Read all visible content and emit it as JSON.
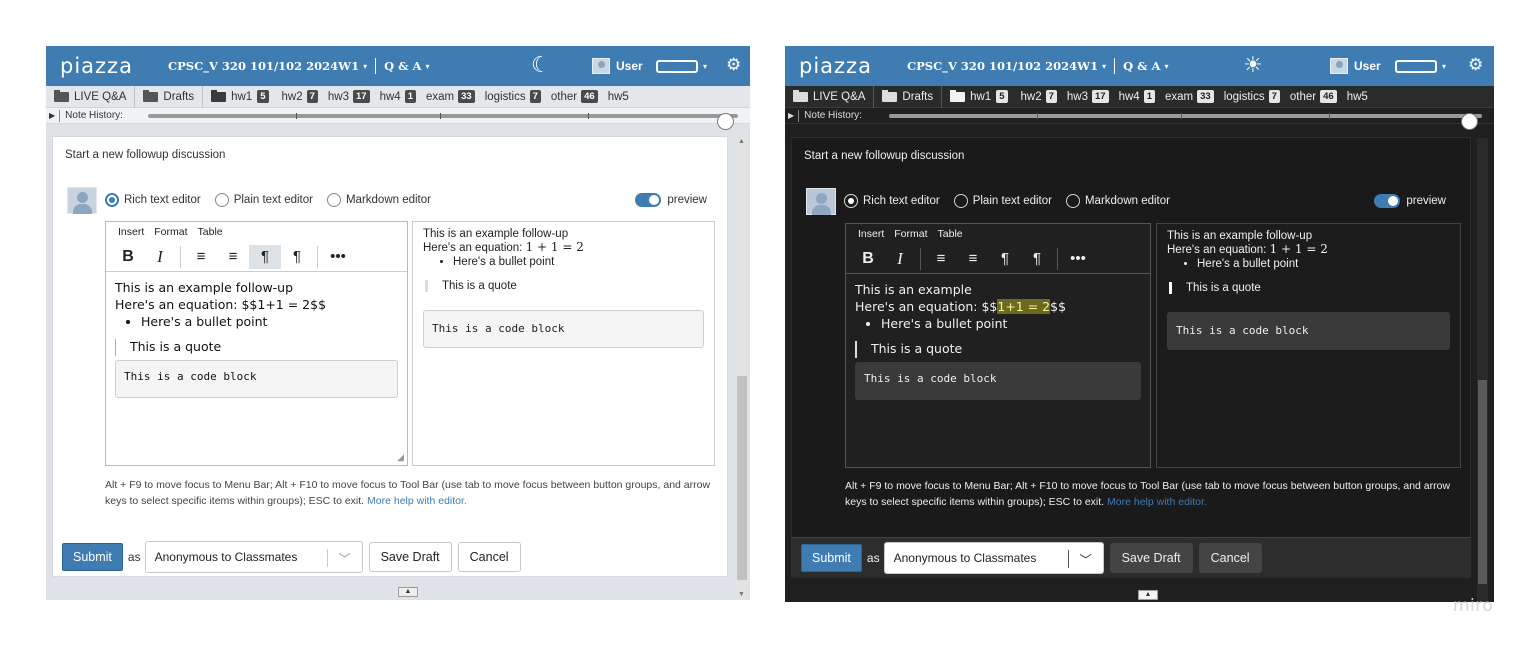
{
  "windows": {
    "light": {
      "header": {
        "logo": "piazza",
        "course": "CPSC_V 320 101/102 2024W1",
        "course_caret": "▾",
        "section": "Q & A",
        "section_caret": "▾",
        "theme_icon": "☾",
        "user": "User",
        "pill_caret": "▾",
        "gear": "⚙"
      },
      "folders": [
        {
          "label": "LIVE Q&A"
        },
        {
          "label": "Drafts"
        },
        {
          "label": "hw1",
          "count": "5"
        },
        {
          "label": "hw2",
          "count": "7"
        },
        {
          "label": "hw3",
          "count": "17"
        },
        {
          "label": "hw4",
          "count": "1"
        },
        {
          "label": "exam",
          "count": "33"
        },
        {
          "label": "logistics",
          "count": "7"
        },
        {
          "label": "other",
          "count": "46"
        },
        {
          "label": "hw5"
        }
      ],
      "history": {
        "triangle": "▶",
        "label": "Note History:"
      },
      "panel": {
        "start": "Start a new followup discussion",
        "radios": [
          "Rich text editor",
          "Plain text editor",
          "Markdown editor"
        ],
        "preview": "preview",
        "menus": [
          "Insert",
          "Format",
          "Table"
        ],
        "tools": {
          "bold": "B",
          "italic": "I",
          "align_left": "≡",
          "align_center": "≡",
          "ltr": "¶",
          "rtl": "¶",
          "more": "•••"
        },
        "editor": {
          "line1": "This is an example follow-up",
          "line2": "Here's an equation: $$1+1 = 2$$",
          "bullet": "Here's a bullet point",
          "quote": "This is a quote",
          "code": "This is a code block"
        },
        "rendered": {
          "line1": "This is an example follow-up",
          "line2_prefix": "Here's an equation: ",
          "math": "1 + 1 = 2",
          "bullet": "Here's a bullet point",
          "quote": "This is a quote",
          "code": "This is a code block"
        },
        "help": "Alt + F9 to move focus to Menu Bar; Alt + F10 to move focus to Tool Bar (use tab to move focus between button groups, and arrow keys to select specific items within groups); ESC to exit.",
        "help_link": "More help with editor."
      },
      "footer": {
        "submit": "Submit",
        "as": "as",
        "select": "Anonymous to Classmates",
        "save": "Save Draft",
        "cancel": "Cancel"
      }
    },
    "dark": {
      "header": {
        "logo": "piazza",
        "course": "CPSC_V 320 101/102 2024W1",
        "course_caret": "▾",
        "section": "Q & A",
        "section_caret": "▾",
        "theme_icon": "☀",
        "user": "User",
        "pill_caret": "▾",
        "gear": "⚙"
      },
      "folders": [
        {
          "label": "LIVE Q&A"
        },
        {
          "label": "Drafts"
        },
        {
          "label": "hw1",
          "count": "5"
        },
        {
          "label": "hw2",
          "count": "7"
        },
        {
          "label": "hw3",
          "count": "17"
        },
        {
          "label": "hw4",
          "count": "1"
        },
        {
          "label": "exam",
          "count": "33"
        },
        {
          "label": "logistics",
          "count": "7"
        },
        {
          "label": "other",
          "count": "46"
        },
        {
          "label": "hw5"
        }
      ],
      "history": {
        "triangle": "▶",
        "label": "Note History:"
      },
      "panel": {
        "start": "Start a new followup discussion",
        "radios": [
          "Rich text editor",
          "Plain text editor",
          "Markdown editor"
        ],
        "preview": "preview",
        "menus": [
          "Insert",
          "Format",
          "Table"
        ],
        "tools": {
          "bold": "B",
          "italic": "I",
          "align_left": "≡",
          "align_center": "≡",
          "ltr": "¶",
          "rtl": "¶",
          "more": "•••"
        },
        "editor": {
          "line1": "This is an example",
          "line2_pre": "Here's an equation: $$",
          "line2_hl": "1+1 = 2",
          "line2_post": "$$",
          "bullet": "Here's a bullet point",
          "quote": "This is a quote",
          "code": "This is a code block"
        },
        "rendered": {
          "line1": "This is an example follow-up",
          "line2_prefix": "Here's an equation: ",
          "math": "1 + 1 = 2",
          "bullet": "Here's a bullet point",
          "quote": "This is a quote",
          "code": "This is a code block"
        },
        "help": "Alt + F9 to move focus to Menu Bar; Alt + F10 to move focus to Tool Bar (use tab to move focus between button groups, and arrow keys to select specific items within groups); ESC to exit.",
        "help_link": "More help with editor."
      },
      "footer": {
        "submit": "Submit",
        "as": "as",
        "select": "Anonymous to Classmates",
        "save": "Save Draft",
        "cancel": "Cancel"
      }
    }
  },
  "watermark": "miro",
  "colors": {
    "brand": "#3e7cb1",
    "dark_bg": "#1a1a1a",
    "highlight": "#6b6a1e"
  }
}
